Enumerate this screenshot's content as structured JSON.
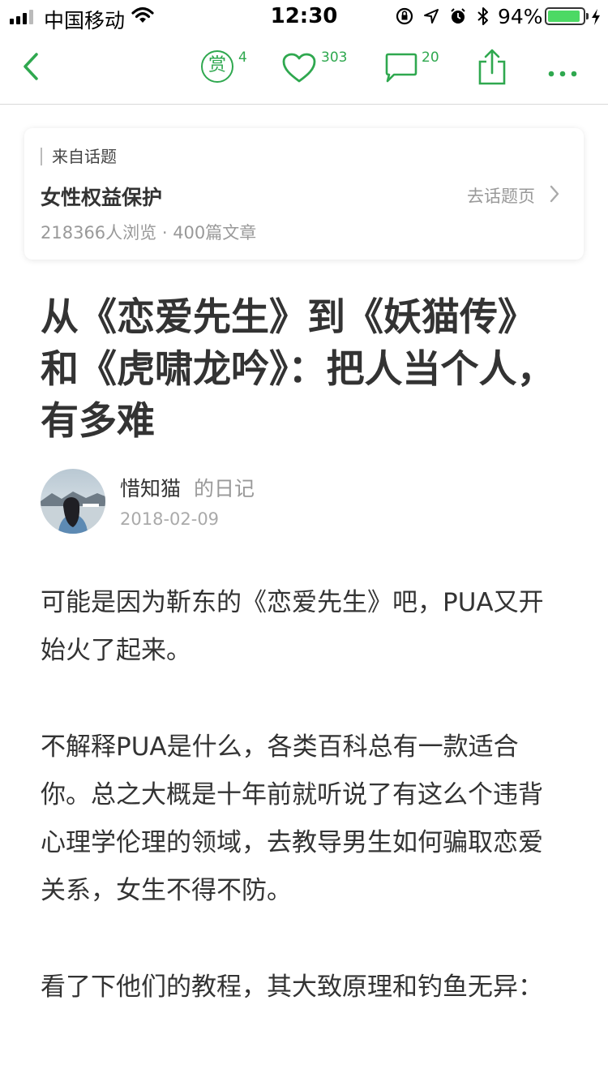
{
  "status_bar": {
    "carrier": "中国移动",
    "time": "12:30",
    "battery_percent": "94%",
    "battery_level": 0.94,
    "icons": [
      "signal-icon",
      "wifi-icon",
      "orientation-lock-icon",
      "location-icon",
      "alarm-icon",
      "bluetooth-icon",
      "battery-icon",
      "charging-icon"
    ]
  },
  "nav": {
    "reward_label": "赏",
    "reward_count": "4",
    "like_count": "303",
    "comment_count": "20",
    "accent_color": "#2fa84f"
  },
  "topic_card": {
    "from_label": "来自话题",
    "topic_name": "女性权益保护",
    "link_label": "去话题页",
    "stats": "218366人浏览 · 400篇文章"
  },
  "article": {
    "title": "从《恋爱先生》到《妖猫传》和《虎啸龙吟》：把人当个人，有多难",
    "author_name": "惜知猫",
    "author_suffix": "的日记",
    "date": "2018-02-09",
    "paragraphs": [
      "可能是因为靳东的《恋爱先生》吧，PUA又开始火了起来。",
      "不解释PUA是什么，各类百科总有一款适合你。总之大概是十年前就听说了有这么个违背心理学伦理的领域，去教导男生如何骗取恋爱关系，女生不得不防。",
      "看了下他们的教程，其大致原理和钓鱼无异："
    ]
  }
}
